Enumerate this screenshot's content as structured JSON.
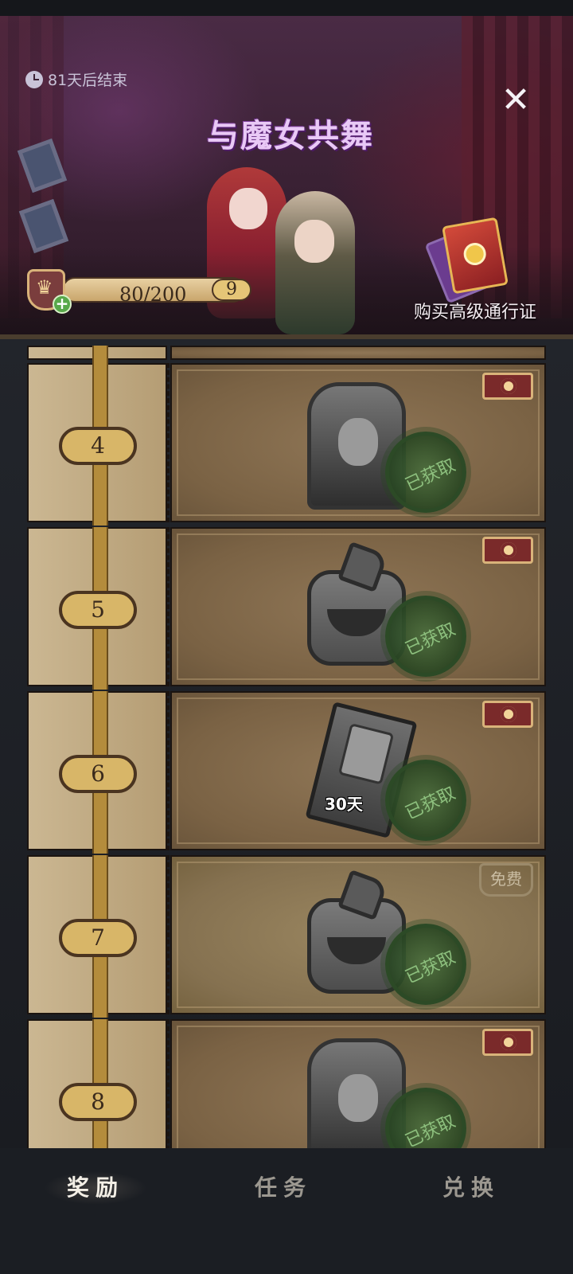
{
  "banner": {
    "timer_text": "81天后结束",
    "event_title": "与魔女共舞",
    "close_symbol": "✕",
    "buy_pass_label": "购买高级通行证",
    "xp_text": "80/200",
    "level": "9",
    "plus_symbol": "+"
  },
  "rewards": [
    {
      "level": "4",
      "tier_tag": "premium",
      "item_icon": "witch-portrait-icon",
      "claimed_label": "已获取"
    },
    {
      "level": "5",
      "tier_tag": "premium",
      "item_icon": "pumpkin-badge-icon",
      "claimed_label": "已获取"
    },
    {
      "level": "6",
      "tier_tag": "premium",
      "item_icon": "character-ticket-icon",
      "item_label": "30天",
      "claimed_label": "已获取"
    },
    {
      "level": "7",
      "tier_tag": "free",
      "free_label": "免费",
      "item_icon": "pumpkin-badge-icon",
      "claimed_label": "已获取"
    },
    {
      "level": "8",
      "tier_tag": "premium",
      "item_icon": "demon-portrait-icon",
      "claimed_label": "已获取"
    }
  ],
  "nav": {
    "tabs": [
      {
        "label": "奖励",
        "active": true
      },
      {
        "label": "任务",
        "active": false
      },
      {
        "label": "兑换",
        "active": false
      }
    ]
  },
  "colors": {
    "accent_gold": "#d8b668",
    "claimed_green": "#8dc07e",
    "premium_red": "#7a2a2a"
  }
}
